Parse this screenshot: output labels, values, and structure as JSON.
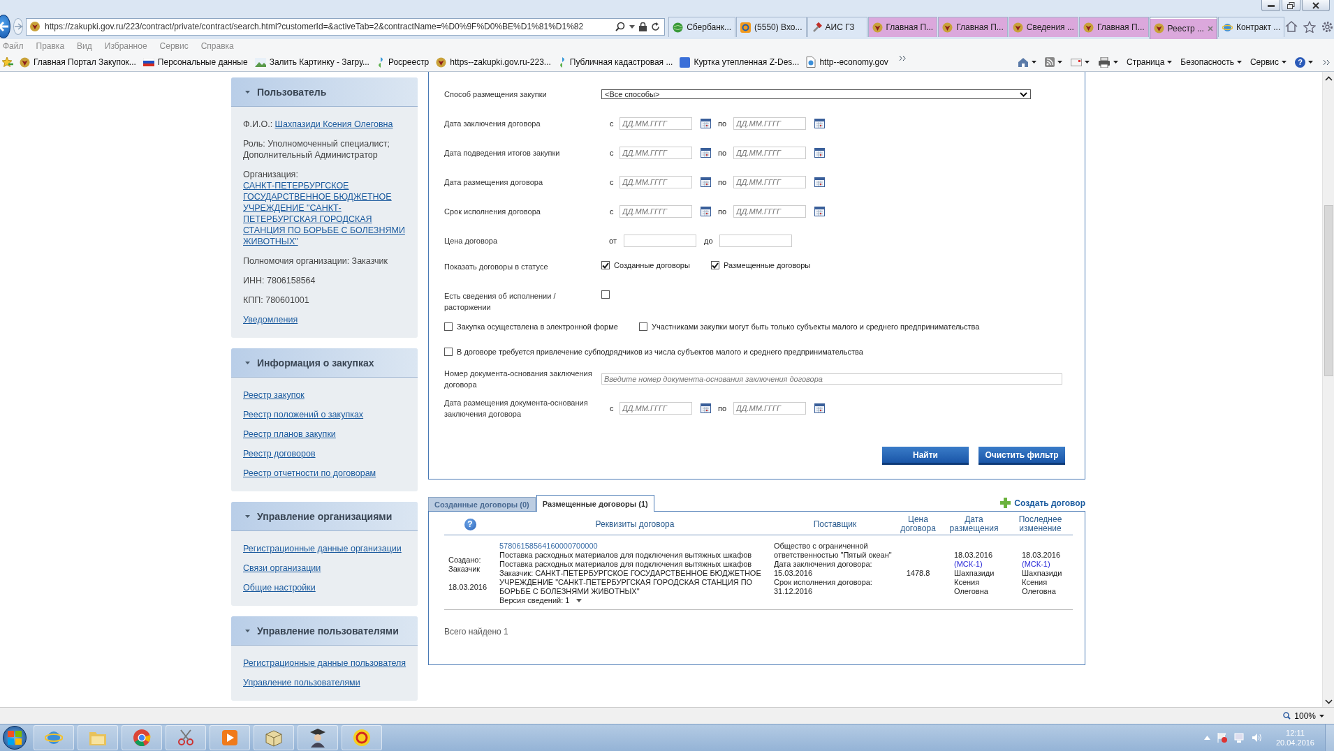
{
  "browser": {
    "address": "https://zakupki.gov.ru/223/contract/private/contract/search.html?customerId=&activeTab=2&contractName=%D0%9F%D0%BE%D1%81%D1%82",
    "tabs": [
      {
        "kind": "bank",
        "label": "Сбербанк...",
        "selected": false,
        "color": "#dce7f5"
      },
      {
        "kind": "mail",
        "label": "(5550) Вхо...",
        "selected": false,
        "color": "#dce7f5"
      },
      {
        "kind": "tool",
        "label": "АИС ГЗ",
        "selected": false,
        "color": "#dce7f5"
      },
      {
        "kind": "emblem",
        "label": "Главная П...",
        "selected": false,
        "color": "#dba8dc"
      },
      {
        "kind": "emblem",
        "label": "Главная П...",
        "selected": false,
        "color": "#dba8dc"
      },
      {
        "kind": "emblem",
        "label": "Сведения ...",
        "selected": false,
        "color": "#dba8dc"
      },
      {
        "kind": "emblem",
        "label": "Главная П...",
        "selected": false,
        "color": "#dba8dc"
      },
      {
        "kind": "emblem",
        "label": "Реестр ...",
        "selected": true,
        "color": "#dba8dc"
      },
      {
        "kind": "ie",
        "label": "Контракт ...",
        "selected": false,
        "color": "#dce7f5"
      }
    ],
    "menu": [
      "Файл",
      "Правка",
      "Вид",
      "Избранное",
      "Сервис",
      "Справка"
    ],
    "favorites": [
      {
        "kind": "emblem",
        "label": "Главная Портал Закупок..."
      },
      {
        "kind": "flag",
        "label": "Персональные данные"
      },
      {
        "kind": "image",
        "label": "Залить Картинку - Загру..."
      },
      {
        "kind": "leaf",
        "label": "Росреестр"
      },
      {
        "kind": "emblem",
        "label": "https--zakupki.gov.ru-223..."
      },
      {
        "kind": "leaf",
        "label": "Публичная кадастровая ..."
      },
      {
        "kind": "square",
        "label": "Куртка утепленная Z-Des..."
      },
      {
        "kind": "page",
        "label": "http--economy.gov"
      }
    ],
    "commands": [
      {
        "kind": "home"
      },
      {
        "kind": "feeds"
      },
      {
        "kind": "mail"
      },
      {
        "kind": "print"
      },
      {
        "kind": "text",
        "label": "Страница"
      },
      {
        "kind": "text",
        "label": "Безопасность"
      },
      {
        "kind": "text",
        "label": "Сервис"
      },
      {
        "kind": "help",
        "label": "?"
      }
    ]
  },
  "sidebar": [
    {
      "title": "Пользователь",
      "items": [
        {
          "kind": "field",
          "label": "Ф.И.О.:",
          "value": "Шахпазиди Ксения Олеговна"
        },
        {
          "kind": "text",
          "label": "Роль: Уполномоченный специалист; Дополнительный Администратор"
        },
        {
          "kind": "field",
          "label": "Организация:",
          "value": "САНКТ-ПЕТЕРБУРГСКОЕ ГОСУДАРСТВЕННОЕ БЮДЖЕТНОЕ УЧРЕЖДЕНИЕ \"САНКТ-ПЕТЕРБУРГСКАЯ ГОРОДСКАЯ СТАНЦИЯ ПО БОРЬБЕ С БОЛЕЗНЯМИ ЖИВОТНЫХ\""
        },
        {
          "kind": "text",
          "label": "Полномочия организации: Заказчик"
        },
        {
          "kind": "text",
          "label": "ИНН: 7806158564"
        },
        {
          "kind": "text",
          "label": "КПП: 780601001"
        },
        {
          "kind": "link",
          "label": "Уведомления"
        }
      ]
    },
    {
      "title": "Информация о закупках",
      "items": [
        {
          "kind": "link",
          "label": "Реестр закупок"
        },
        {
          "kind": "link",
          "label": "Реестр положений о закупках"
        },
        {
          "kind": "link",
          "label": "Реестр планов закупки"
        },
        {
          "kind": "link",
          "label": "Реестр договоров"
        },
        {
          "kind": "link",
          "label": "Реестр отчетности по договорам"
        }
      ]
    },
    {
      "title": "Управление организациями",
      "items": [
        {
          "kind": "link",
          "label": "Регистрационные данные организации"
        },
        {
          "kind": "link",
          "label": "Связи организации"
        },
        {
          "kind": "link",
          "label": "Общие настройки"
        }
      ]
    },
    {
      "title": "Управление пользователями",
      "items": [
        {
          "kind": "link",
          "label": "Регистрационные данные пользователя"
        },
        {
          "kind": "link",
          "label": "Управление пользователями"
        }
      ]
    }
  ],
  "filter": {
    "rows": [
      {
        "kind": "select",
        "label": "Способ размещения закупки",
        "value": "<Все способы>"
      },
      {
        "kind": "dates",
        "label": "Дата заключения договора",
        "from": "с",
        "to": "по",
        "from_field": {
          "placeholder": "ДД.ММ.ГГГГ"
        },
        "to_field": {
          "placeholder": "ДД.ММ.ГГГГ"
        }
      },
      {
        "kind": "dates",
        "label": "Дата подведения итогов закупки",
        "from": "с",
        "to": "по",
        "from_field": {
          "placeholder": "ДД.ММ.ГГГГ"
        },
        "to_field": {
          "placeholder": "ДД.ММ.ГГГГ"
        }
      },
      {
        "kind": "dates",
        "label": "Дата размещения договора",
        "from": "с",
        "to": "по",
        "from_field": {
          "placeholder": "ДД.ММ.ГГГГ"
        },
        "to_field": {
          "placeholder": "ДД.ММ.ГГГГ"
        }
      },
      {
        "kind": "dates",
        "label": "Срок исполнения договора",
        "from": "с",
        "to": "по",
        "from_field": {
          "placeholder": "ДД.ММ.ГГГГ"
        },
        "to_field": {
          "placeholder": "ДД.ММ.ГГГГ"
        }
      },
      {
        "kind": "range",
        "label": "Цена договора",
        "from": "от",
        "to": "до"
      },
      {
        "kind": "checks",
        "label": "Показать договоры в статусе",
        "options": [
          {
            "label": "Созданные договоры",
            "checked": true
          },
          {
            "label": "Размещенные договоры",
            "checked": true
          }
        ]
      },
      {
        "kind": "checks",
        "label": "Есть сведения об исполнении / расторжении",
        "options": [
          {
            "checked": false
          }
        ]
      },
      {
        "kind": "wide",
        "options": [
          {
            "label": "Закупка осуществлена в электронной форме",
            "checked": false
          },
          {
            "label": "Участниками закупки могут быть только субъекты малого и среднего предпринимательства",
            "checked": false
          }
        ]
      },
      {
        "kind": "wide",
        "options": [
          {
            "label": "В договоре требуется привлечение субподрядчиков из числа субъектов малого и среднего предпринимательства",
            "checked": false
          }
        ]
      },
      {
        "kind": "text",
        "label": "Номер документа-основания заключения договора",
        "placeholder": "Введите номер документа-основания заключения договора"
      },
      {
        "kind": "dates",
        "label": "Дата размещения документа-основания заключения договора",
        "from": "с",
        "to": "по",
        "from_field": {
          "placeholder": "ДД.ММ.ГГГГ"
        },
        "to_field": {
          "placeholder": "ДД.ММ.ГГГГ"
        }
      }
    ],
    "buttons": [
      "Найти",
      "Очистить фильтр"
    ]
  },
  "results": {
    "tabs": [
      {
        "label": "Созданные договоры (0)",
        "selected": false
      },
      {
        "label": "Размещенные договоры (1)",
        "selected": true
      }
    ],
    "create": "Создать договор",
    "help": "?",
    "columns": [
      "Реквизиты договора",
      "Поставщик",
      "Цена договора",
      "Дата размещения",
      "Последнее изменение"
    ],
    "rows": [
      {
        "status": "Создано: Заказчик",
        "status_date": "18.03.2016",
        "number": "57806158564160000700000",
        "lines": [
          "Поставка расходных материалов для подключения вытяжных шкафов",
          "Поставка расходных материалов для подключения вытяжных шкафов",
          "Заказчик: САНКТ-ПЕТЕРБУРГСКОЕ ГОСУДАРСТВЕННОЕ БЮДЖЕТНОЕ УЧРЕЖДЕНИЕ \"САНКТ-ПЕТЕРБУРГСКАЯ ГОРОДСКАЯ СТАНЦИЯ ПО БОРЬБЕ С БОЛЕЗНЯМИ ЖИВОТНЫХ\""
        ],
        "version": "Версия сведений: 1",
        "supplier": [
          "Общество с ограниченной ответственностью \"Пятый океан\"",
          "Дата заключения договора: 15.03.2016",
          "Срок исполнения договора: 31.12.2016"
        ],
        "price": "1478.8",
        "placed": {
          "date": "18.03.2016",
          "tz": "(МСК-1)",
          "by": "Шахпазиди Ксения Олеговна"
        },
        "changed": {
          "date": "18.03.2016",
          "tz": "(МСК-1)",
          "by": "Шахпазиди Ксения Олеговна"
        }
      }
    ],
    "total": "Всего найдено 1"
  },
  "status_bar": {
    "zoom": "100%"
  },
  "taskbar": {
    "time": "12:11",
    "date": "20.04.2016"
  }
}
